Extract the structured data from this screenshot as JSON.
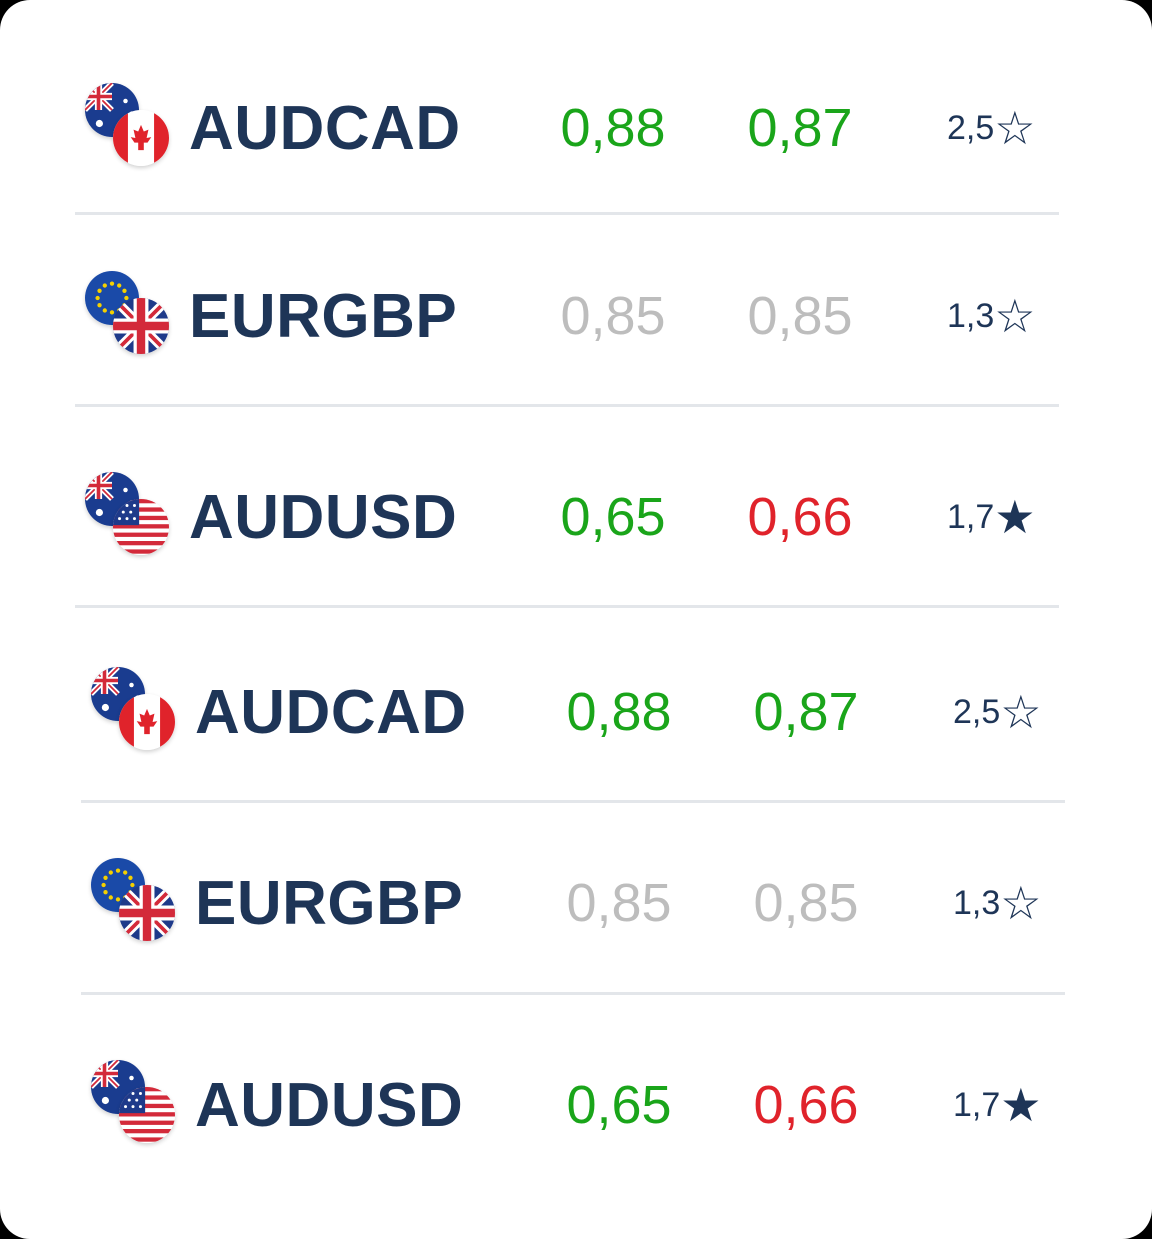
{
  "colors": {
    "up": "#1aa51a",
    "down": "#e0232b",
    "flat": "#bdbdbd",
    "text": "#1e3557"
  },
  "rows": [
    {
      "pair": "AUDCAD",
      "flags": [
        "australia",
        "canada"
      ],
      "bid": "0,88",
      "ask": "0,87",
      "bid_state": "up",
      "ask_state": "up",
      "rating": "2,5",
      "star": "☆",
      "starred": false
    },
    {
      "pair": "EURGBP",
      "flags": [
        "eu",
        "uk"
      ],
      "bid": "0,85",
      "ask": "0,85",
      "bid_state": "flat",
      "ask_state": "flat",
      "rating": "1,3",
      "star": "☆",
      "starred": false
    },
    {
      "pair": "AUDUSD",
      "flags": [
        "australia",
        "usa"
      ],
      "bid": "0,65",
      "ask": "0,66",
      "bid_state": "up",
      "ask_state": "down",
      "rating": "1,7",
      "star": "★",
      "starred": true
    },
    {
      "pair": "AUDCAD",
      "flags": [
        "australia",
        "canada"
      ],
      "bid": "0,88",
      "ask": "0,87",
      "bid_state": "up",
      "ask_state": "up",
      "rating": "2,5",
      "star": "☆",
      "starred": false
    },
    {
      "pair": "EURGBP",
      "flags": [
        "eu",
        "uk"
      ],
      "bid": "0,85",
      "ask": "0,85",
      "bid_state": "flat",
      "ask_state": "flat",
      "rating": "1,3",
      "star": "☆",
      "starred": false
    },
    {
      "pair": "AUDUSD",
      "flags": [
        "australia",
        "usa"
      ],
      "bid": "0,65",
      "ask": "0,66",
      "bid_state": "up",
      "ask_state": "down",
      "rating": "1,7",
      "star": "★",
      "starred": true
    }
  ]
}
